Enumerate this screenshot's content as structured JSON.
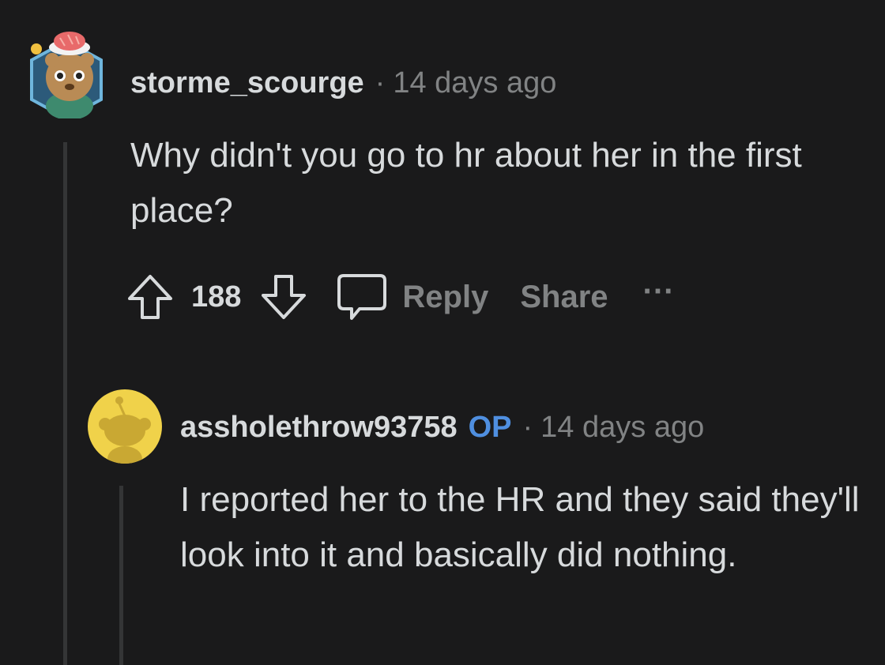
{
  "comment": {
    "username": "storme_scourge",
    "separator": "·",
    "timestamp": "14 days ago",
    "body": "Why didn't you go to hr about her in the first place?",
    "votes": "188",
    "actions": {
      "reply": "Reply",
      "share": "Share",
      "more": "···"
    },
    "avatar_icon": "snoo-avatar-bear-with-sushi-hat",
    "icons": [
      "upvote-arrow-icon",
      "downvote-arrow-icon",
      "comment-bubble-icon",
      "more-options-icon"
    ]
  },
  "reply": {
    "username": "assholethrow93758",
    "op_badge": "OP",
    "separator": "·",
    "timestamp": "14 days ago",
    "body": "I reported her to the HR and they said they'll look into it and basically did nothing.",
    "avatar_icon": "default-snoo-avatar"
  },
  "colors": {
    "background": "#1a1a1b",
    "text": "#d7dadc",
    "muted": "#818384",
    "op_blue": "#4f8fe0",
    "thread_line": "#343536",
    "default_avatar_bg": "#f0d24a"
  }
}
